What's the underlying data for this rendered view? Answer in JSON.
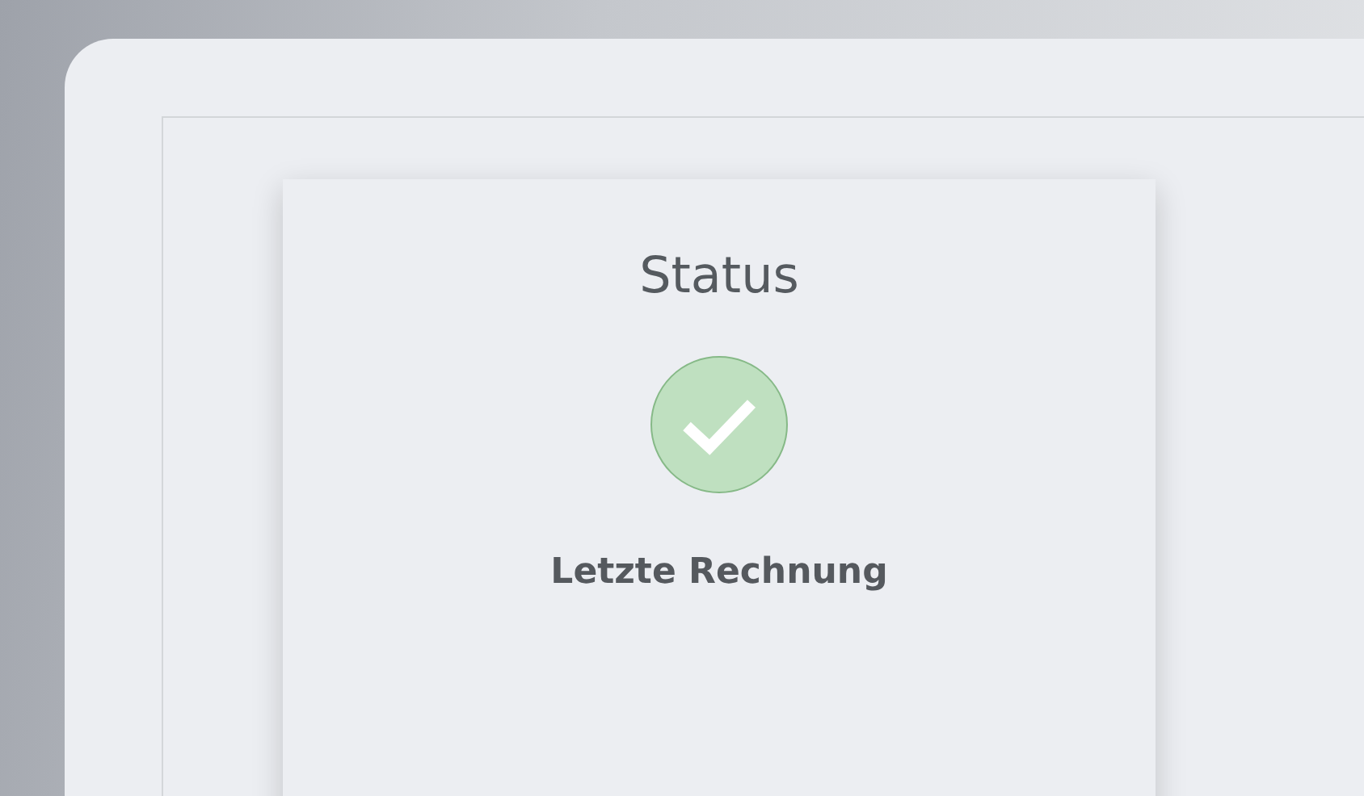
{
  "card": {
    "title": "Status",
    "success": true,
    "label": "Letzte Rechnung"
  }
}
